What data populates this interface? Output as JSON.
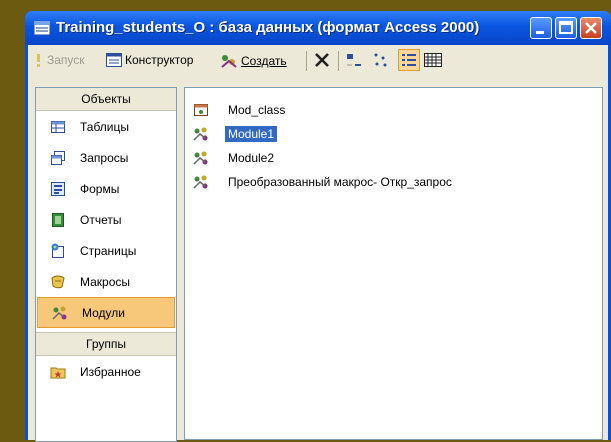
{
  "window": {
    "title": "Training_students_O : база данных (формат Access 2000)"
  },
  "toolbar": {
    "run_label": "Запуск",
    "design_label": "Конструктор",
    "create_label": "Создать"
  },
  "sidebar": {
    "objects_header": "Объекты",
    "items": [
      {
        "label": "Таблицы",
        "icon": "table-icon"
      },
      {
        "label": "Запросы",
        "icon": "query-icon"
      },
      {
        "label": "Формы",
        "icon": "form-icon"
      },
      {
        "label": "Отчеты",
        "icon": "report-icon"
      },
      {
        "label": "Страницы",
        "icon": "page-icon"
      },
      {
        "label": "Макросы",
        "icon": "macro-icon"
      },
      {
        "label": "Модули",
        "icon": "module-icon",
        "selected": true
      }
    ],
    "groups_header": "Группы",
    "groups": [
      {
        "label": "Избранное",
        "icon": "favorites-folder-icon"
      }
    ]
  },
  "list": {
    "items": [
      {
        "label": "Mod_class",
        "icon": "class-module-icon"
      },
      {
        "label": "Module1",
        "icon": "module-icon",
        "selected": true
      },
      {
        "label": "Module2",
        "icon": "module-icon"
      },
      {
        "label": "Преобразованный макрос- Откр_запрос",
        "icon": "module-icon"
      }
    ]
  },
  "colors": {
    "titlebar": "#0a55e0",
    "selection": "#316ac5",
    "sidebar_selected": "#f8c87a"
  }
}
